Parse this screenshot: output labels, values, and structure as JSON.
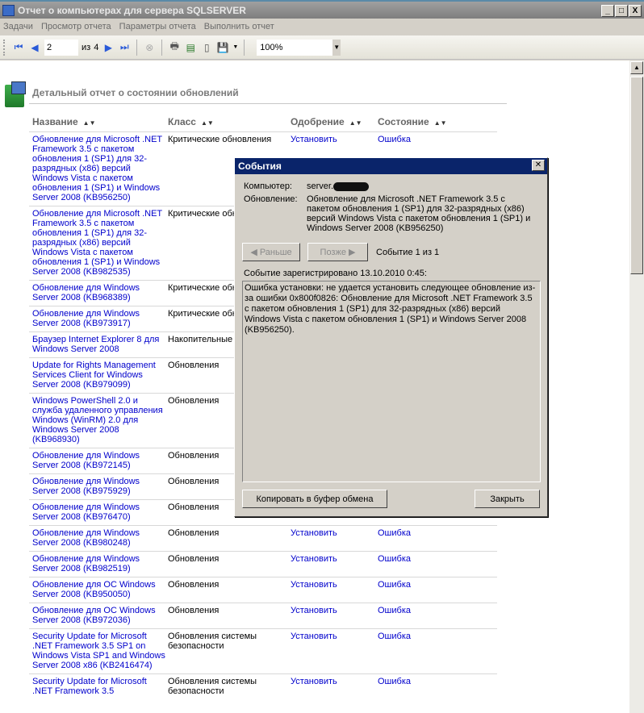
{
  "window": {
    "title": "Отчет о компьютерах для сервера SQLSERVER",
    "minimize": "_",
    "maximize": "□",
    "close": "X"
  },
  "menu": [
    "Задачи",
    "Просмотр отчета",
    "Параметры отчета",
    "Выполнить отчет"
  ],
  "toolbar": {
    "page": "2",
    "of_label": "из",
    "total": "4",
    "zoom": "100%"
  },
  "report": {
    "title": "Детальный отчет о состоянии обновлений",
    "columns": [
      "Название",
      "Класс",
      "Одобрение",
      "Состояние"
    ],
    "rows": [
      {
        "name": "Обновление для Microsoft .NET Framework 3.5 с пакетом обновления 1 (SP1) для 32-разрядных (x86) версий Windows Vista с пакетом обновления 1 (SP1) и Windows Server 2008 (KB956250)",
        "class": "Критические обновления",
        "approval": "Установить",
        "status": "Ошибка"
      },
      {
        "name": "Обновление для Microsoft .NET Framework 3.5 с пакетом обновления 1 (SP1) для 32-разрядных (x86) версий Windows Vista с пакетом обновления 1 (SP1) и Windows Server 2008 (KB982535)",
        "class": "Критические обновления",
        "approval": "",
        "status": ""
      },
      {
        "name": "Обновление для Windows Server 2008 (KB968389)",
        "class": "Критические обновления",
        "approval": "",
        "status": ""
      },
      {
        "name": "Обновление для Windows Server 2008 (KB973917)",
        "class": "Критические обновления",
        "approval": "",
        "status": ""
      },
      {
        "name": "Браузер Internet Explorer 8 для Windows Server 2008",
        "class": "Накопительные обновления",
        "approval": "",
        "status": ""
      },
      {
        "name": "Update for Rights Management Services Client for Windows Server 2008 (KB979099)",
        "class": "Обновления",
        "approval": "",
        "status": ""
      },
      {
        "name": "Windows PowerShell 2.0 и служба удаленного управления Windows (WinRM) 2.0 для Windows Server 2008 (KB968930)",
        "class": "Обновления",
        "approval": "",
        "status": ""
      },
      {
        "name": "Обновление для Windows Server 2008 (KB972145)",
        "class": "Обновления",
        "approval": "",
        "status": ""
      },
      {
        "name": "Обновление для Windows Server 2008 (KB975929)",
        "class": "Обновления",
        "approval": "",
        "status": ""
      },
      {
        "name": "Обновление для Windows Server 2008 (KB976470)",
        "class": "Обновления",
        "approval": "",
        "status": ""
      },
      {
        "name": "Обновление для Windows Server 2008 (KB980248)",
        "class": "Обновления",
        "approval": "Установить",
        "status": "Ошибка"
      },
      {
        "name": "Обновление для Windows Server 2008 (KB982519)",
        "class": "Обновления",
        "approval": "Установить",
        "status": "Ошибка"
      },
      {
        "name": "Обновление для ОС Windows Server 2008 (KB950050)",
        "class": "Обновления",
        "approval": "Установить",
        "status": "Ошибка"
      },
      {
        "name": "Обновление для ОС Windows Server 2008 (KB972036)",
        "class": "Обновления",
        "approval": "Установить",
        "status": "Ошибка"
      },
      {
        "name": "Security Update for Microsoft .NET Framework 3.5 SP1 on Windows Vista SP1 and Windows Server 2008 x86 (KB2416474)",
        "class": "Обновления системы безопасности",
        "approval": "Установить",
        "status": "Ошибка"
      },
      {
        "name": "Security Update for Microsoft .NET Framework 3.5",
        "class": "Обновления системы безопасности",
        "approval": "Установить",
        "status": "Ошибка"
      }
    ]
  },
  "dialog": {
    "title": "События",
    "computer_label": "Компьютер:",
    "computer_value": "server.",
    "update_label": "Обновление:",
    "update_value": "Обновление для Microsoft .NET Framework 3.5 с пакетом обновления 1 (SP1) для 32-разрядных (x86) версий Windows Vista с пакетом обновления 1 (SP1) и Windows Server 2008 (KB956250)",
    "prev": "Раньше",
    "next": "Позже",
    "counter": "Событие 1 из 1",
    "logged": "Событие зарегистрировано 13.10.2010 0:45:",
    "message": "Ошибка установки: не удается установить следующее обновление из-за ошибки 0x800f0826: Обновление для Microsoft .NET Framework 3.5 с пакетом обновления 1 (SP1) для 32-разрядных (x86) версий Windows Vista с пакетом обновления 1 (SP1) и Windows Server 2008 (KB956250).",
    "copy": "Копировать в буфер обмена",
    "close": "Закрыть"
  }
}
